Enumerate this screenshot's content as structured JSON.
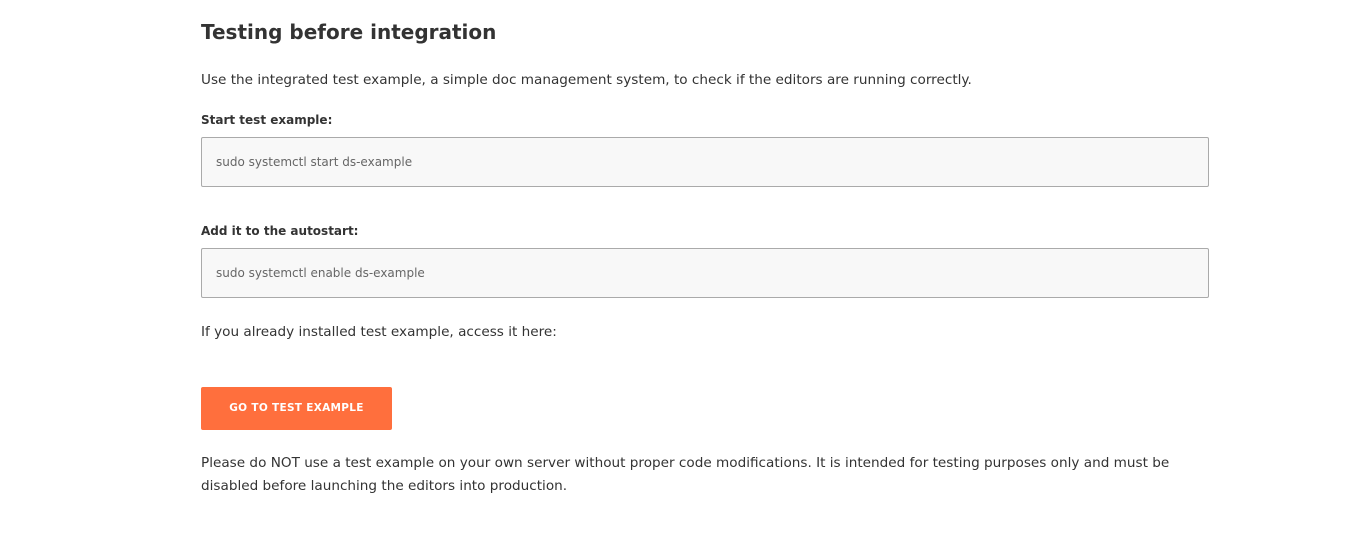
{
  "section": {
    "title": "Testing before integration",
    "intro": "Use the integrated test example, a simple doc management system, to check if the editors are running correctly."
  },
  "start_block": {
    "label": "Start test example:",
    "command": "sudo systemctl start ds-example"
  },
  "autostart_block": {
    "label": "Add it to the autostart:",
    "command": "sudo systemctl enable ds-example"
  },
  "access": {
    "text": "If you already installed test example, access it here:",
    "button_label": "GO TO TEST EXAMPLE"
  },
  "warning": {
    "text": "Please do NOT use a test example on your own server without proper code modifications. It is intended for testing purposes only and must be disabled before launching the editors into production."
  },
  "colors": {
    "button_bg": "#ff6f3d",
    "text": "#333333",
    "box_bg": "#f8f8f8",
    "box_border": "#aaaaaa"
  }
}
